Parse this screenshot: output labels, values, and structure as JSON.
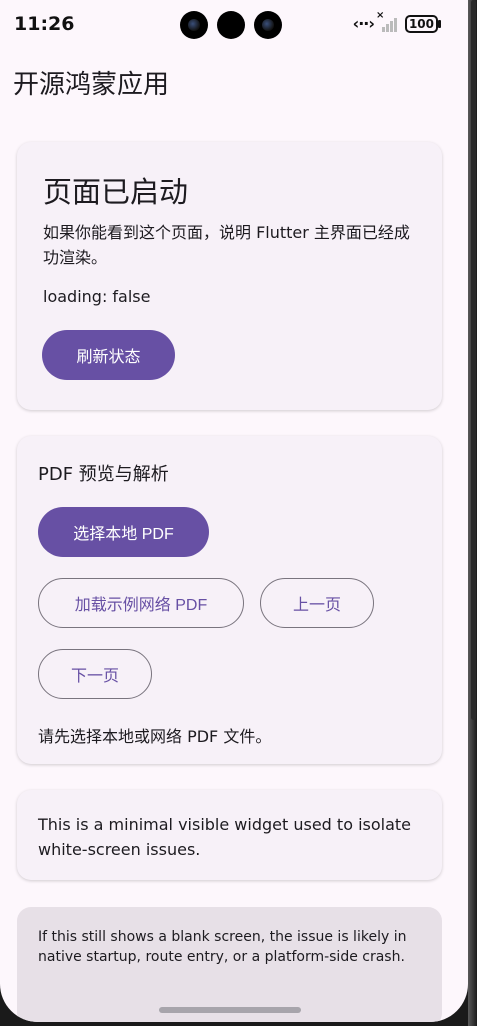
{
  "status_bar": {
    "time": "11:26",
    "battery": "100",
    "icons": [
      "network-arrows-icon",
      "signal-off-icon",
      "battery-icon"
    ]
  },
  "app_bar": {
    "title": "开源鸿蒙应用"
  },
  "status_card": {
    "title": "页面已启动",
    "description": "如果你能看到这个页面，说明 Flutter 主界面已经成功渲染。",
    "loading_text": "loading: false",
    "refresh_label": "刷新状态"
  },
  "pdf_card": {
    "title": "PDF 预览与解析",
    "select_local_label": "选择本地 PDF",
    "load_sample_label": "加载示例网络 PDF",
    "prev_page_label": "上一页",
    "next_page_label": "下一页",
    "hint": "请先选择本地或网络 PDF 文件。"
  },
  "widget_card": {
    "text": "This is a minimal visible widget used to isolate white-screen issues."
  },
  "note_card": {
    "text": "If this still shows a blank screen, the issue is likely in native startup, route entry, or a platform-side crash."
  },
  "colors": {
    "primary": "#6750a4",
    "background": "#fdf7fc",
    "card": "#f7f1f8",
    "note_card": "#e7e0e7"
  }
}
